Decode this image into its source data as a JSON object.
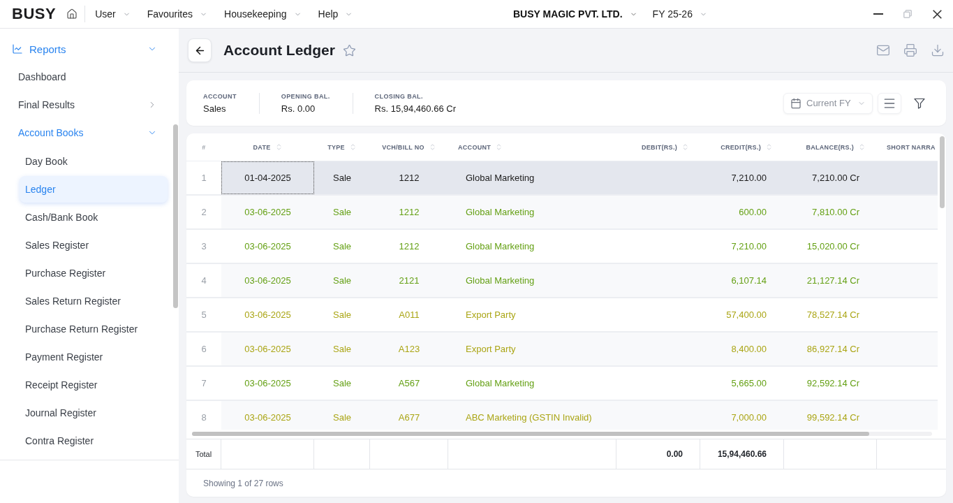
{
  "top_bar": {
    "logo": "BUSY",
    "menus": [
      {
        "label": "User"
      },
      {
        "label": "Favourites"
      },
      {
        "label": "Housekeeping"
      },
      {
        "label": "Help"
      }
    ],
    "company": "BUSY MAGIC PVT. LTD.",
    "financial_year": "FY 25-26",
    "window_controls": [
      {
        "kind": "minimize",
        "disabled": false
      },
      {
        "kind": "restore",
        "disabled": true
      },
      {
        "kind": "close",
        "disabled": false
      }
    ]
  },
  "sidebar": {
    "items": [
      {
        "label": "Reports",
        "expanded": true,
        "children": [
          {
            "label": "Dashboard",
            "selected": false
          },
          {
            "label": "Final Results",
            "expanded": false,
            "selected": false
          },
          {
            "label": "Account Books",
            "expanded": true,
            "selected": false,
            "children": [
              {
                "label": "Day Book",
                "selected": false
              },
              {
                "label": "Ledger",
                "selected": true
              },
              {
                "label": "Cash/Bank Book",
                "selected": false
              },
              {
                "label": "Sales Register",
                "selected": false
              },
              {
                "label": "Purchase Register",
                "selected": false
              },
              {
                "label": "Sales Return Register",
                "selected": false
              },
              {
                "label": "Purchase Return Register",
                "selected": false
              },
              {
                "label": "Payment Register",
                "selected": false
              },
              {
                "label": "Receipt Register",
                "selected": false
              },
              {
                "label": "Journal Register",
                "selected": false
              },
              {
                "label": "Contra Register",
                "selected": false
              }
            ]
          }
        ]
      }
    ]
  },
  "page": {
    "title": "Account Ledger",
    "favourite": false
  },
  "summary": {
    "fields": [
      {
        "label": "ACCOUNT",
        "value": "Sales"
      },
      {
        "label": "OPENING BAL.",
        "value": "Rs. 0.00"
      },
      {
        "label": "CLOSING BAL.",
        "value": "Rs. 15,94,460.66 Cr"
      }
    ],
    "period": "Current FY"
  },
  "table": {
    "columns": [
      {
        "label": "#",
        "sortable": false
      },
      {
        "label": "DATE",
        "sortable": true
      },
      {
        "label": "TYPE",
        "sortable": true
      },
      {
        "label": "VCH/BILL NO",
        "sortable": true
      },
      {
        "label": "ACCOUNT",
        "sortable": true
      },
      {
        "label": "DEBIT(RS.)",
        "sortable": true
      },
      {
        "label": "CREDIT(RS.)",
        "sortable": true
      },
      {
        "label": "BALANCE(RS.)",
        "sortable": true
      },
      {
        "label": "SHORT NARRA"
      }
    ],
    "rows": [
      {
        "number": "1",
        "date": "01-04-2025",
        "type": "Sale",
        "vch_bill_no": "1212",
        "account": "Global Marketing",
        "credit": "7,210.00",
        "balance": "7,210.00 Cr",
        "selected": true
      },
      {
        "number": "2",
        "date": "03-06-2025",
        "type": "Sale",
        "vch_bill_no": "1212",
        "account": "Global Marketing",
        "credit": "600.00",
        "balance": "7,810.00 Cr",
        "selected": false,
        "color": "#64a014"
      },
      {
        "number": "3",
        "date": "03-06-2025",
        "type": "Sale",
        "vch_bill_no": "1212",
        "account": "Global Marketing",
        "credit": "7,210.00",
        "balance": "15,020.00 Cr",
        "selected": false,
        "color": "#64a014"
      },
      {
        "number": "4",
        "date": "03-06-2025",
        "type": "Sale",
        "vch_bill_no": "2121",
        "account": "Global Marketing",
        "credit": "6,107.14",
        "balance": "21,127.14 Cr",
        "selected": false,
        "color": "#64a014"
      },
      {
        "number": "5",
        "date": "03-06-2025",
        "type": "Sale",
        "vch_bill_no": "A011",
        "account": "Export Party",
        "credit": "57,400.00",
        "balance": "78,527.14 Cr",
        "selected": false,
        "color": "#aaa514"
      },
      {
        "number": "6",
        "date": "03-06-2025",
        "type": "Sale",
        "vch_bill_no": "A123",
        "account": "Export Party",
        "credit": "8,400.00",
        "balance": "86,927.14 Cr",
        "selected": false,
        "color": "#aaa514"
      },
      {
        "number": "7",
        "date": "03-06-2025",
        "type": "Sale",
        "vch_bill_no": "A567",
        "account": "Global Marketing",
        "credit": "5,665.00",
        "balance": "92,592.14 Cr",
        "selected": false,
        "color": "#64a014"
      },
      {
        "number": "8",
        "date": "03-06-2025",
        "type": "Sale",
        "vch_bill_no": "A677",
        "account": "ABC Marketing (GSTIN Invalid)",
        "credit": "7,000.00",
        "balance": "99,592.14 Cr",
        "selected": false,
        "color": "#aaa514"
      }
    ],
    "totals": {
      "label": "Total",
      "debit": "0.00",
      "credit": "15,94,460.66"
    }
  },
  "footer": "Showing 1 of 27 rows"
}
